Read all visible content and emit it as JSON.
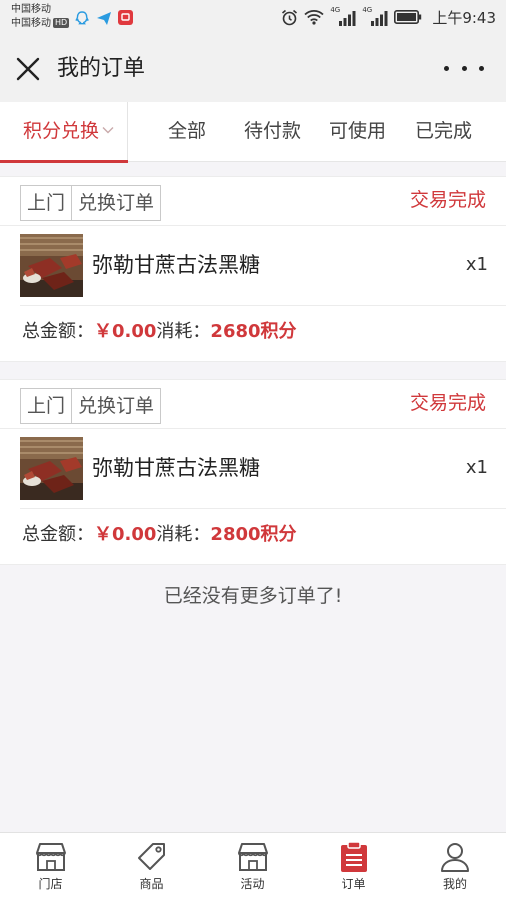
{
  "statusbar": {
    "carrier1": "中国移动",
    "carrier2": "中国移动",
    "hd": "HD",
    "signal1": "4G",
    "signal2": "4G",
    "time": "上午9:43"
  },
  "navbar": {
    "title": "我的订单"
  },
  "tabs": {
    "active": "积分兑换",
    "items": [
      "全部",
      "待付款",
      "可使用",
      "已完成"
    ]
  },
  "orders": [
    {
      "type_left": "上门",
      "type_right": "兑换订单",
      "status": "交易完成",
      "product": "弥勒甘蔗古法黑糖",
      "qty": "x1",
      "total_label": "总金额：",
      "total_value": "￥0.00",
      "cost_label": "消耗：",
      "cost_value": "2680积分"
    },
    {
      "type_left": "上门",
      "type_right": "兑换订单",
      "status": "交易完成",
      "product": "弥勒甘蔗古法黑糖",
      "qty": "x1",
      "total_label": "总金额：",
      "total_value": "￥0.00",
      "cost_label": "消耗：",
      "cost_value": "2800积分"
    }
  ],
  "no_more": "已经没有更多订单了!",
  "bottom_nav": [
    {
      "label": "门店",
      "icon": "store-icon"
    },
    {
      "label": "商品",
      "icon": "tag-icon"
    },
    {
      "label": "活动",
      "icon": "store-icon"
    },
    {
      "label": "订单",
      "icon": "order-clipboard-icon"
    },
    {
      "label": "我的",
      "icon": "user-icon"
    }
  ],
  "colors": {
    "accent": "#d0383b",
    "bar_bg": "#f1f1f1",
    "page_bg": "#f5f4f7"
  }
}
